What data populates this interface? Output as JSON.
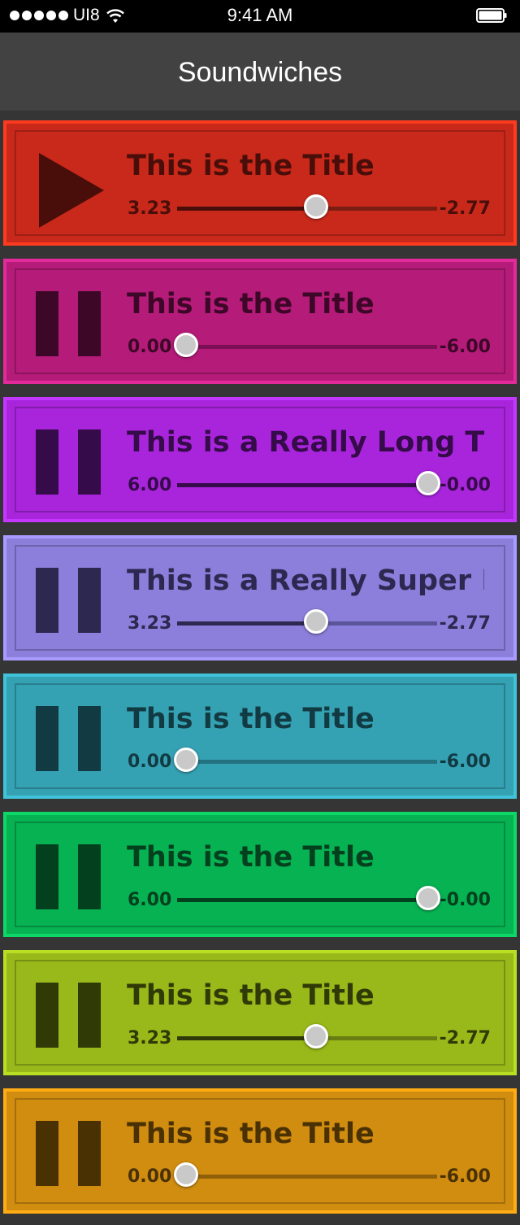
{
  "status_bar": {
    "carrier": "UI8",
    "time": "9:41 AM"
  },
  "nav": {
    "title": "Soundwiches"
  },
  "tracks": [
    {
      "title": "This is the Title",
      "elapsed": "3.23",
      "remaining": "-2.77",
      "progress": 0.538,
      "state": "paused",
      "icon": "play-icon",
      "bg": "#c8291a",
      "border": "#ff3b1f",
      "dark": "#4a0e0a",
      "track": "#7a1e14"
    },
    {
      "title": "This is the Title",
      "elapsed": "0.00",
      "remaining": "-6.00",
      "progress": 0.0,
      "state": "playing",
      "icon": "pause-icon",
      "bg": "#b51b79",
      "border": "#e32a9b",
      "dark": "#3d0828",
      "track": "#7d1054"
    },
    {
      "title": "This is a Really Long Title",
      "elapsed": "6.00",
      "remaining": "-0.00",
      "progress": 1.0,
      "state": "playing",
      "icon": "pause-icon",
      "bg": "#a825dc",
      "border": "#c437ff",
      "dark": "#360b4a",
      "track": "#6e1890"
    },
    {
      "title": "This is a Really Super Lo...",
      "elapsed": "3.23",
      "remaining": "-2.77",
      "progress": 0.538,
      "state": "playing",
      "icon": "pause-icon",
      "bg": "#8b7fdb",
      "border": "#a89aff",
      "dark": "#2c2850",
      "track": "#5a549a"
    },
    {
      "title": "This is the Title",
      "elapsed": "0.00",
      "remaining": "-6.00",
      "progress": 0.0,
      "state": "playing",
      "icon": "pause-icon",
      "bg": "#35a2b4",
      "border": "#40c3d9",
      "dark": "#123a42",
      "track": "#247280"
    },
    {
      "title": "This is the Title",
      "elapsed": "6.00",
      "remaining": "-0.00",
      "progress": 1.0,
      "state": "playing",
      "icon": "pause-icon",
      "bg": "#07b253",
      "border": "#0dd766",
      "dark": "#03401e",
      "track": "#057a38"
    },
    {
      "title": "This is the Title",
      "elapsed": "3.23",
      "remaining": "-2.77",
      "progress": 0.538,
      "state": "playing",
      "icon": "pause-icon",
      "bg": "#99b81a",
      "border": "#b8df21",
      "dark": "#2f3a06",
      "track": "#687d12"
    },
    {
      "title": "This is the Title",
      "elapsed": "0.00",
      "remaining": "-6.00",
      "progress": 0.0,
      "state": "playing",
      "icon": "pause-icon",
      "bg": "#d18d10",
      "border": "#ffab14",
      "dark": "#4a3104",
      "track": "#8f600a"
    }
  ]
}
